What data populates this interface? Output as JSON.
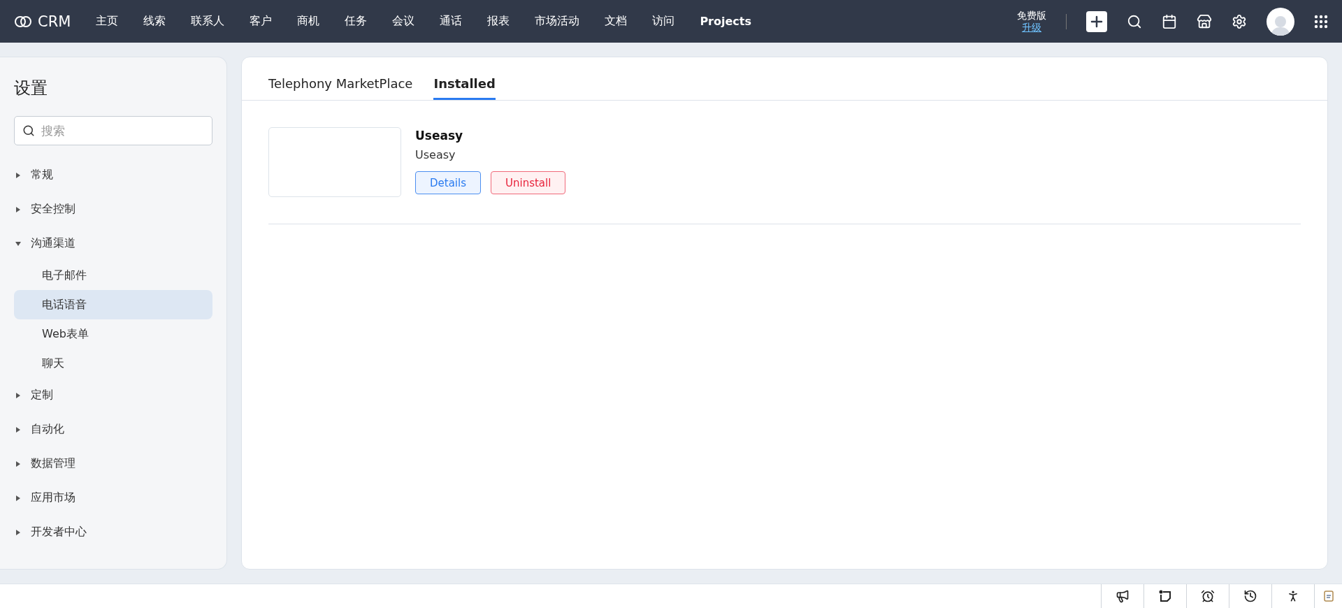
{
  "topbar": {
    "logo": "CRM",
    "nav": [
      {
        "label": "主页",
        "selected": false
      },
      {
        "label": "线索",
        "selected": false
      },
      {
        "label": "联系人",
        "selected": false
      },
      {
        "label": "客户",
        "selected": false
      },
      {
        "label": "商机",
        "selected": false
      },
      {
        "label": "任务",
        "selected": false
      },
      {
        "label": "会议",
        "selected": false
      },
      {
        "label": "通话",
        "selected": false
      },
      {
        "label": "报表",
        "selected": false
      },
      {
        "label": "市场活动",
        "selected": false
      },
      {
        "label": "文档",
        "selected": false
      },
      {
        "label": "访问",
        "selected": false
      },
      {
        "label": "Projects",
        "selected": true
      }
    ],
    "plan": "免费版",
    "upgrade": "升级"
  },
  "sidebar": {
    "title": "设置",
    "search": {
      "placeholder": "搜索"
    },
    "items": [
      {
        "label": "常规",
        "expanded": false
      },
      {
        "label": "安全控制",
        "expanded": false
      },
      {
        "label": "沟通渠道",
        "expanded": true,
        "children": [
          {
            "label": "电子邮件",
            "selected": false
          },
          {
            "label": "电话语音",
            "selected": true
          },
          {
            "label": "Web表单",
            "selected": false
          },
          {
            "label": "聊天",
            "selected": false
          }
        ]
      },
      {
        "label": "定制",
        "expanded": false
      },
      {
        "label": "自动化",
        "expanded": false
      },
      {
        "label": "数据管理",
        "expanded": false
      },
      {
        "label": "应用市场",
        "expanded": false
      },
      {
        "label": "开发者中心",
        "expanded": false
      }
    ]
  },
  "tabs": [
    {
      "label": "Telephony MarketPlace",
      "selected": false
    },
    {
      "label": "Installed",
      "selected": true
    }
  ],
  "apps": [
    {
      "name": "Useasy",
      "vendor": "Useasy",
      "buttons": [
        {
          "label": "Details",
          "kind": "primary"
        },
        {
          "label": "Uninstall",
          "kind": "danger"
        }
      ]
    }
  ]
}
